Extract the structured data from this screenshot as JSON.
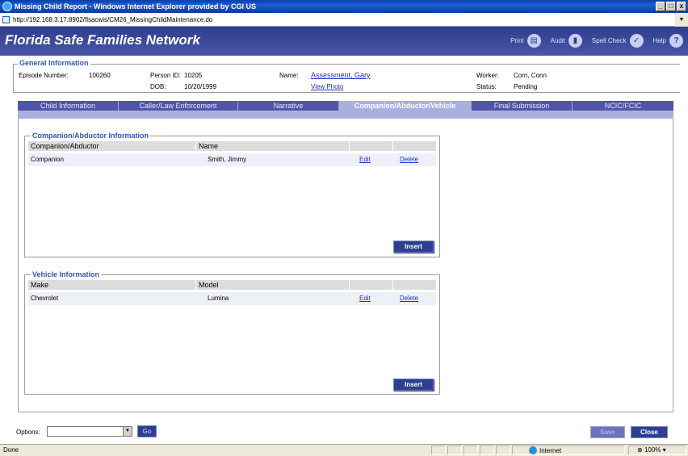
{
  "window": {
    "title": "Missing Child Report - Windows Internet Explorer provided by CGI US",
    "url": "http://192.168.3.17:8902/flsacwis/CM26_MissingChildMaintenance.do",
    "min": "_",
    "max": "□",
    "close": "x"
  },
  "header": {
    "app_title": "Florida Safe Families Network",
    "print": "Print",
    "audit": "Audit",
    "spell_check": "Spell Check",
    "help": "Help",
    "help_glyph": "?"
  },
  "general": {
    "legend": "General Information",
    "episode_label": "Episode Number:",
    "episode_value": "100260",
    "person_label": "Person ID:",
    "person_value": "10205",
    "dob_label": "DOB:",
    "dob_value": "10/20/1999",
    "name_label": "Name:",
    "name_value": "Assessment, Gary",
    "view_photo": "View Photo",
    "worker_label": "Worker:",
    "worker_value": "Corn, Conn",
    "status_label": "Status:",
    "status_value": "Pending"
  },
  "tabs": [
    "Child Information",
    "Caller/Law Enforcement",
    "Narrative",
    "Companion/Abductor/Vehicle",
    "Final Submission",
    "NCIC/FCIC"
  ],
  "companion": {
    "legend": "Companion/Abductor Information",
    "col1": "Companion/Abductor",
    "col2": "Name",
    "rows": [
      {
        "type": "Companion",
        "name": "Smith,  Jimmy",
        "edit": "Edit",
        "delete": "Delete"
      }
    ],
    "insert": "Insert"
  },
  "vehicle": {
    "legend": "Vehicle Information",
    "col1": "Make",
    "col2": "Model",
    "rows": [
      {
        "make": "Chevrolet",
        "model": "Lumina",
        "edit": "Edit",
        "delete": "Delete"
      }
    ],
    "insert": "Insert"
  },
  "footer": {
    "options_label": "Options:",
    "go": "Go",
    "save": "Save",
    "close": "Close"
  },
  "status": {
    "left": "Done",
    "zone": "Internet",
    "zoom": "100%"
  }
}
